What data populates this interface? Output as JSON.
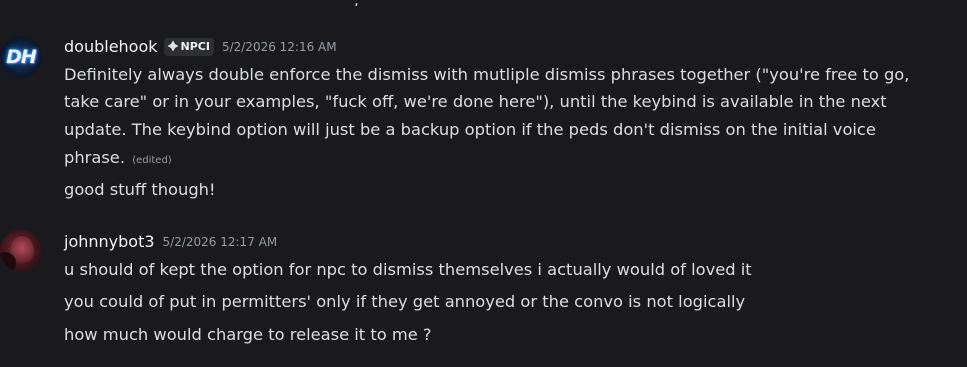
{
  "messages": [
    {
      "author": "doublehook",
      "avatar_initials": "DH",
      "role_tag": "NPCI",
      "role_icon": "diamond-icon",
      "timestamp": "5/2/2026 12:16 AM",
      "lines": [
        "Definitely always double enforce the dismiss with mutliple dismiss phrases together (\"you're free to go,",
        "take care\" or in your examples, \"fuck off, we're done here\"), until the keybind is available in the next",
        "update. The keybind option will just be a backup option if the peds don't dismiss on the initial voice",
        "phrase."
      ],
      "edited_label": "(edited)",
      "followup": "good stuff though!"
    },
    {
      "author": "johnnybot3",
      "timestamp": "5/2/2026 12:17 AM",
      "lines": [
        "u should of kept the option for npc to dismiss themselves i actually would of loved it",
        "you could of put in permitters' only if they get annoyed or the convo is not logically",
        "how much would charge to release it to me ?"
      ]
    }
  ],
  "colors": {
    "background": "#1a1a1e",
    "text": "#dbdee1",
    "username": "#f2f3f5",
    "muted": "#949ba4",
    "tag_background": "#2e2f35"
  }
}
